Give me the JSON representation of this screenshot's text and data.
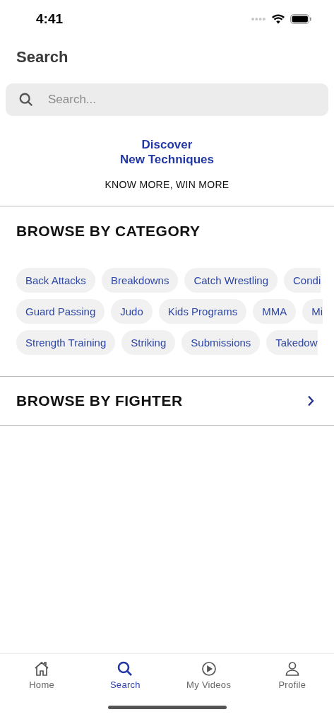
{
  "status_bar": {
    "time": "4:41"
  },
  "header": {
    "title": "Search"
  },
  "search": {
    "placeholder": "Search..."
  },
  "promo": {
    "title_lines": [
      "Discover",
      "New Techniques"
    ],
    "tagline": "KNOW MORE, WIN MORE"
  },
  "browse_by_category": {
    "heading": "BROWSE BY CATEGORY",
    "rows": [
      [
        {
          "label": "Back Attacks",
          "kind": "full"
        },
        {
          "label": "Breakdowns",
          "kind": "full"
        },
        {
          "label": "Catch Wrestling",
          "kind": "full"
        },
        {
          "label": "Condi",
          "kind": "cut"
        }
      ],
      [
        {
          "label": "Guard Passing",
          "kind": "full"
        },
        {
          "label": "Judo",
          "kind": "full"
        },
        {
          "label": "Kids Programs",
          "kind": "full"
        },
        {
          "label": "MMA",
          "kind": "full"
        },
        {
          "label": "Mi",
          "kind": "cut"
        }
      ],
      [
        {
          "label": "Strength Training",
          "kind": "full"
        },
        {
          "label": "Striking",
          "kind": "full"
        },
        {
          "label": "Submissions",
          "kind": "full"
        },
        {
          "label": "Takedow",
          "kind": "cut"
        }
      ]
    ]
  },
  "browse_by_fighter": {
    "heading": "BROWSE BY FIGHTER"
  },
  "tab_bar": [
    {
      "label": "Home",
      "kind": "home",
      "selected": false
    },
    {
      "label": "Search",
      "kind": "search",
      "selected": true
    },
    {
      "label": "My Videos",
      "kind": "videos",
      "selected": false
    },
    {
      "label": "Profile",
      "kind": "profile",
      "selected": false
    }
  ]
}
